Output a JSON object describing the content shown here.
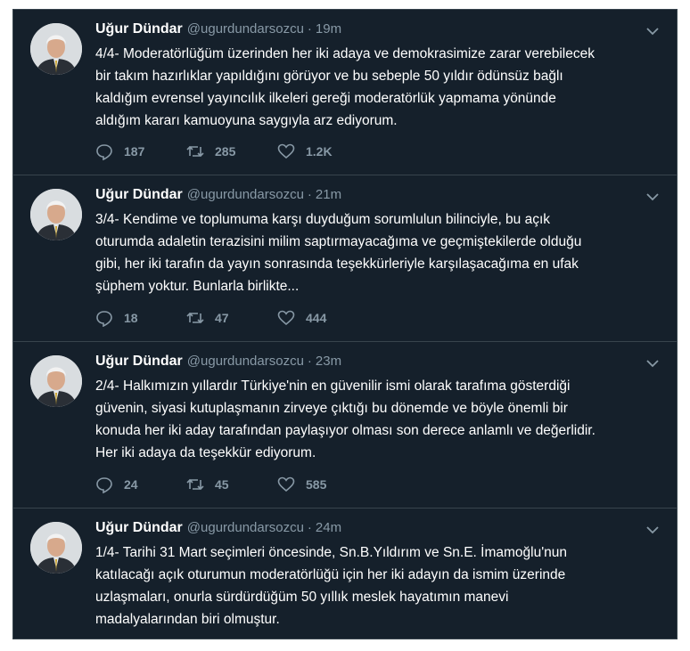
{
  "tweets": [
    {
      "name": "Uğur Dündar",
      "handle": "@ugurdundarsozcu",
      "time": "19m",
      "text": "4/4- Moderatörlüğüm üzerinden her iki adaya ve demokrasimize zarar verebilecek\nbir takım hazırlıklar yapıldığını görüyor ve bu sebeple 50 yıldır ödünsüz bağlı\nkaldığım evrensel yayıncılık ilkeleri gereği moderatörlük yapmama yönünde\naldığım kararı kamuoyuna saygıyla arz ediyorum.",
      "replies": "187",
      "retweets": "285",
      "likes": "1.2K"
    },
    {
      "name": "Uğur Dündar",
      "handle": "@ugurdundarsozcu",
      "time": "21m",
      "text": "3/4- Kendime ve toplumuma karşı duyduğum sorumlulun bilinciyle, bu açık\noturumda adaletin terazisini milim saptırmayacağıma ve geçmiştekilerde olduğu\ngibi, her iki tarafın da yayın sonrasında teşekkürleriyle karşılaşacağıma en ufak\nşüphem yoktur. Bunlarla birlikte...",
      "replies": "18",
      "retweets": "47",
      "likes": "444"
    },
    {
      "name": "Uğur Dündar",
      "handle": "@ugurdundarsozcu",
      "time": "23m",
      "text": "2/4- Halkımızın yıllardır Türkiye'nin en güvenilir ismi olarak tarafıma gösterdiği\ngüvenin, siyasi kutuplaşmanın zirveye çıktığı bu dönemde ve böyle önemli bir\nkonuda her iki aday tarafından paylaşıyor olması son derece anlamlı ve değerlidir.\nHer iki adaya da teşekkür ediyorum.",
      "replies": "24",
      "retweets": "45",
      "likes": "585"
    },
    {
      "name": "Uğur Dündar",
      "handle": "@ugurdundarsozcu",
      "time": "24m",
      "text": "1/4- Tarihi 31 Mart seçimleri öncesinde, Sn.B.Yıldırım ve Sn.E. İmamoğlu'nun\nkatılacağı açık oturumun moderatörlüğü için her iki adayın da ismim üzerinde\nuzlaşmaları, onurla sürdürdüğüm 50 yıllık meslek hayatımın manevi\nmadalyalarından biri olmuştur."
    }
  ],
  "dot": "·",
  "icons": {
    "reply": "reply-icon",
    "retweet": "retweet-icon",
    "like": "like-icon",
    "caret": "chevron-down-icon"
  },
  "colors": {
    "background": "#15202b",
    "border": "#38444d",
    "text": "#ffffff",
    "muted": "#8899a6"
  }
}
